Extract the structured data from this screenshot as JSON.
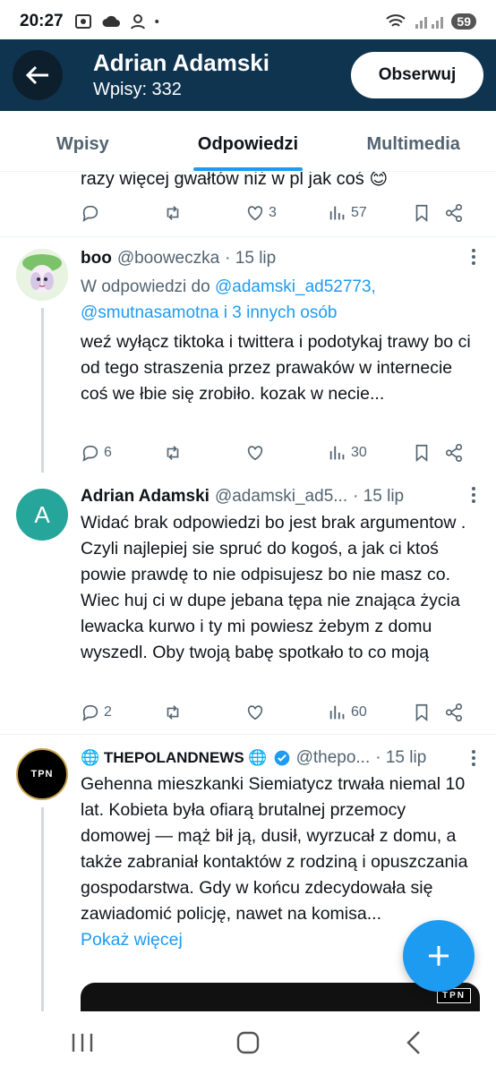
{
  "status_bar": {
    "time": "20:27",
    "battery": "59"
  },
  "header": {
    "name": "Adrian Adamski",
    "posts_label": "Wpisy: 332",
    "follow_label": "Obserwuj"
  },
  "tabs": [
    {
      "label": "Wpisy",
      "active": false
    },
    {
      "label": "Odpowiedzi",
      "active": true
    },
    {
      "label": "Multimedia",
      "active": false
    }
  ],
  "partial_tweet": {
    "text": "razy więcej gwałtów niż w pl jak coś 😊",
    "replies": "",
    "likes": "3",
    "views": "57"
  },
  "tweets": [
    {
      "name": "boo",
      "handle": "@booweczka",
      "date": "· 15 lip",
      "reply_prefix": "W odpowiedzi do",
      "reply_targets": "@adamski_ad52773, @smutnasamotna i 3 innych osób",
      "text": "weź wyłącz tiktoka i twittera i podotykaj trawy bo ci od tego straszenia przez prawaków w internecie coś we łbie się zrobiło. kozak w necie...",
      "replies": "6",
      "likes": "",
      "views": "30"
    },
    {
      "name": "Adrian Adamski",
      "handle": "@adamski_ad5...",
      "date": "· 15 lip",
      "avatar_letter": "A",
      "text": "Widać brak odpowiedzi bo jest brak argumentow . Czyli najlepiej sie spruć do kogoś, a jak ci ktoś powie prawdę to nie odpisujesz bo nie masz co. Wiec huj ci w dupe jebana tępa nie znająca życia lewacka kurwo i ty mi powiesz żebym z domu wyszedl. Oby twoją babę spotkało to co moją",
      "replies": "2",
      "likes": "",
      "views": "60"
    },
    {
      "name": "🌐 THEPOLANDNEWS 🌐",
      "handle": "@thepo...",
      "date": "· 15 lip",
      "avatar_text": "TPN",
      "text": "Gehenna mieszkanki Siemiatycz trwała niemal 10 lat. Kobieta była ofiarą brutalnej przemocy domowej — mąż bił ją, dusił, wyrzucał z domu, a także zabraniał kontaktów z rodziną i opuszczania gospodarstwa. Gdy w końcu zdecydowała się zawiadomić policję, nawet na komisa...",
      "show_more": "Pokaż więcej",
      "media_badge": "TPN"
    }
  ],
  "colors": {
    "header_bg": "#0f3450",
    "accent": "#1d9bf0",
    "muted": "#536471"
  },
  "icons": [
    "back-arrow-icon",
    "reply-icon",
    "retweet-icon",
    "like-icon",
    "views-icon",
    "bookmark-icon",
    "share-icon",
    "verified-icon",
    "more-icon",
    "compose-plus-icon"
  ]
}
